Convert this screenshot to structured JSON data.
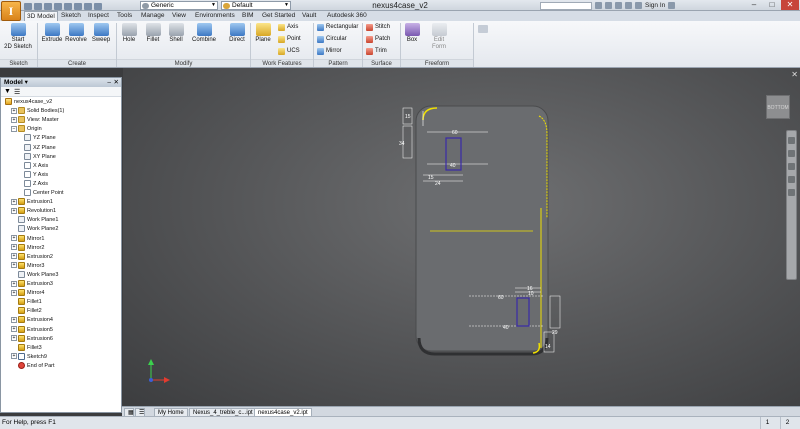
{
  "titlebar": {
    "doc_title": "nexus4case_v2",
    "material": "Generic",
    "appearance": "Default",
    "search_placeholder": "",
    "sign_in": "Sign In",
    "app_button": "I"
  },
  "tabs": [
    "3D Model",
    "Sketch",
    "Inspect",
    "Tools",
    "Manage",
    "View",
    "Environments",
    "BIM",
    "Get Started",
    "Vault",
    "Autodesk 360"
  ],
  "ribbon": {
    "sketch": {
      "label": "Sketch",
      "start": "Start",
      "start2": "2D Sketch"
    },
    "create": {
      "label": "Create",
      "extrude": "Extrude",
      "revolve": "Revolve",
      "sweep": "Sweep"
    },
    "modify": {
      "label": "Modify",
      "hole": "Hole",
      "fillet": "Fillet",
      "shell": "Shell",
      "combine": "Combine",
      "direct": "Direct"
    },
    "work": {
      "label": "Work Features",
      "plane": "Plane",
      "axis": "Axis",
      "point": "Point",
      "ucs": "UCS"
    },
    "pattern": {
      "label": "Pattern",
      "rect": "Rectangular",
      "circ": "Circular",
      "mirror": "Mirror"
    },
    "surface": {
      "label": "Surface",
      "stitch": "Stitch",
      "patch": "Patch",
      "trim": "Trim"
    },
    "freeform": {
      "label": "Freeform",
      "box": "Box",
      "edit": "Edit",
      "edit2": "Form"
    }
  },
  "browser": {
    "title": "Model",
    "items": [
      {
        "label": "nexus4case_v2",
        "icon": "part"
      },
      {
        "label": "Solid Bodies(1)",
        "icon": "fold"
      },
      {
        "label": "View: Master",
        "icon": "fold"
      },
      {
        "label": "Origin",
        "icon": "fold"
      },
      {
        "label": "YZ Plane",
        "icon": "plane"
      },
      {
        "label": "XZ Plane",
        "icon": "plane"
      },
      {
        "label": "XY Plane",
        "icon": "plane"
      },
      {
        "label": "X Axis",
        "icon": "axis"
      },
      {
        "label": "Y Axis",
        "icon": "axis"
      },
      {
        "label": "Z Axis",
        "icon": "axis"
      },
      {
        "label": "Center Point",
        "icon": "axis"
      },
      {
        "label": "Extrusion1",
        "icon": "feat"
      },
      {
        "label": "Revolution1",
        "icon": "feat"
      },
      {
        "label": "Work Plane1",
        "icon": "plane"
      },
      {
        "label": "Work Plane2",
        "icon": "plane"
      },
      {
        "label": "Mirror1",
        "icon": "feat"
      },
      {
        "label": "Mirror2",
        "icon": "feat"
      },
      {
        "label": "Extrusion2",
        "icon": "feat"
      },
      {
        "label": "Mirror3",
        "icon": "feat"
      },
      {
        "label": "Work Plane3",
        "icon": "plane"
      },
      {
        "label": "Extrusion3",
        "icon": "feat"
      },
      {
        "label": "Mirror4",
        "icon": "feat"
      },
      {
        "label": "Fillet1",
        "icon": "feat"
      },
      {
        "label": "Fillet2",
        "icon": "feat"
      },
      {
        "label": "Extrusion4",
        "icon": "feat"
      },
      {
        "label": "Extrusion5",
        "icon": "feat"
      },
      {
        "label": "Extrusion6",
        "icon": "feat"
      },
      {
        "label": "Fillet3",
        "icon": "feat"
      },
      {
        "label": "Sketch9",
        "icon": "sketch"
      },
      {
        "label": "End of Part",
        "icon": "end"
      }
    ]
  },
  "viewport": {
    "viewcube_label": "BOTTOM",
    "dims": {
      "d15": "15",
      "d34": "34",
      "d60": "60",
      "d40": "40",
      "d15b": "15",
      "d24": "24",
      "d16": "16",
      "d10": "10",
      "d60b": "60",
      "d40b": "40",
      "d29": "29",
      "d14": "14"
    }
  },
  "doctabs": [
    "My Home",
    "Nexus_4_treble_c...ipt",
    "nexus4case_v2.ipt"
  ],
  "status": {
    "help": "For Help, press F1",
    "n1": "1",
    "n2": "2"
  }
}
